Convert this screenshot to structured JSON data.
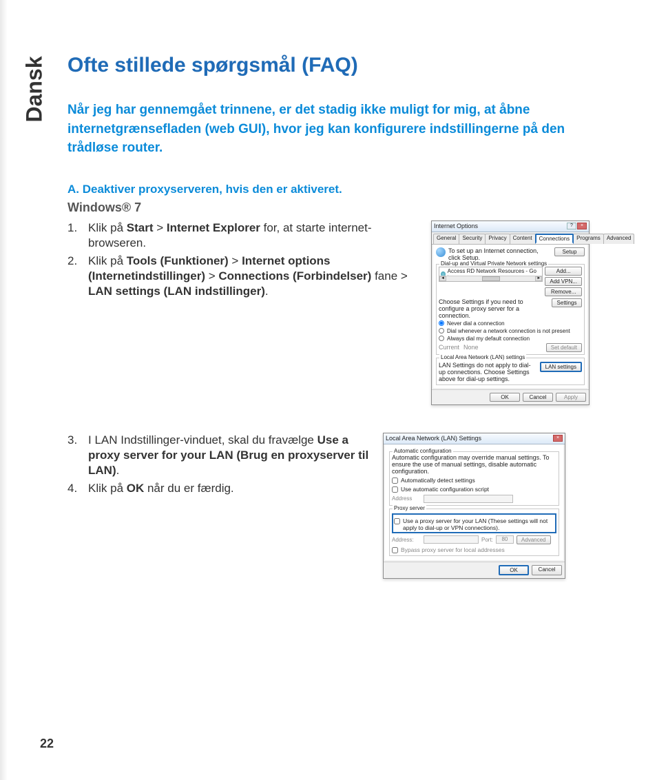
{
  "language_tab": "Dansk",
  "page_number": "22",
  "faq": {
    "heading": "Ofte stillede spørgsmål (FAQ)",
    "question": "Når jeg har gennemgået trinnene, er det stadig ikke muligt for mig, at åbne internetgrænsefladen (web GUI), hvor jeg kan konfigurere indstillingerne på den trådløse router.",
    "section_a": "A.   Deaktiver proxyserveren, hvis den er aktiveret.",
    "windows_label": "Windows® 7",
    "steps12": {
      "n1": "1.",
      "s1a": "Klik på ",
      "s1b": "Start",
      "s1c": " > ",
      "s1d": "Internet Explorer",
      "s1e": " for, at starte internet-browseren.",
      "n2": "2.",
      "s2a": "Klik på ",
      "s2b": "Tools (Funktioner)",
      "s2c": " > ",
      "s2d": "Internet options (Internetindstillinger)",
      "s2e": " > ",
      "s2f": "Connections (Forbindelser)",
      "s2g": " fane > ",
      "s2h": "LAN settings (LAN indstillinger)",
      "s2i": "."
    },
    "steps34": {
      "n3": "3.",
      "s3a": "I LAN Indstillinger-vinduet, skal du fravælge ",
      "s3b": "Use a proxy server for your LAN (Brug en proxyserver til LAN)",
      "s3c": ".",
      "n4": "4.",
      "s4a": "Klik på ",
      "s4b": "OK",
      "s4c": " når du er færdig."
    }
  },
  "dlg1": {
    "title": "Internet Options",
    "tabs": [
      "General",
      "Security",
      "Privacy",
      "Content",
      "Connections",
      "Programs",
      "Advanced"
    ],
    "msg": "To set up an Internet connection, click Setup.",
    "setup_btn": "Setup",
    "group1": "Dial-up and Virtual Private Network settings",
    "list_item": "Access RD Network Resources - Go to vpn.as",
    "add_btn": "Add...",
    "addvpn_btn": "Add VPN...",
    "remove_btn": "Remove...",
    "choose_txt": "Choose Settings if you need to configure a proxy server for a connection.",
    "settings_btn": "Settings",
    "radio1": "Never dial a connection",
    "radio2": "Dial whenever a network connection is not present",
    "radio3": "Always dial my default connection",
    "current_lbl": "Current",
    "current_val": "None",
    "setdefault_btn": "Set default",
    "group2": "Local Area Network (LAN) settings",
    "lan_txt": "LAN Settings do not apply to dial-up connections. Choose Settings above for dial-up settings.",
    "lan_btn": "LAN settings",
    "ok": "OK",
    "cancel": "Cancel",
    "apply": "Apply"
  },
  "dlg2": {
    "title": "Local Area Network (LAN) Settings",
    "group1": "Automatic configuration",
    "auto_txt": "Automatic configuration may override manual settings. To ensure the use of manual settings, disable automatic configuration.",
    "chk_auto": "Automatically detect settings",
    "chk_script": "Use automatic configuration script",
    "address_lbl": "Address",
    "group2": "Proxy server",
    "chk_proxy": "Use a proxy server for your LAN (These settings will not apply to dial-up or VPN connections).",
    "addr2_lbl": "Address:",
    "port_lbl": "Port:",
    "port_val": "80",
    "advanced_btn": "Advanced",
    "chk_bypass": "Bypass proxy server for local addresses",
    "ok": "OK",
    "cancel": "Cancel"
  }
}
